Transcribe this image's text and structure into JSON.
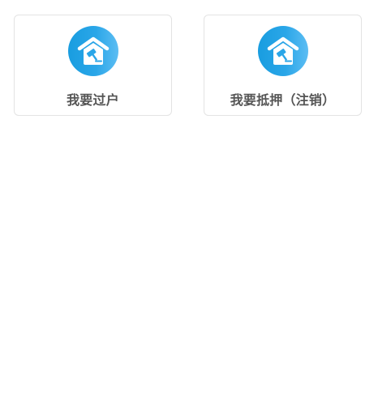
{
  "cards": [
    {
      "label": "我要过户",
      "icon": "house-gavel-icon"
    },
    {
      "label": "我要抵押（注销）",
      "icon": "house-gavel-icon"
    }
  ],
  "colors": {
    "icon_gradient_start": "#199de0",
    "icon_gradient_end": "#5cbdf3",
    "label_text": "#555555",
    "card_border": "#e3e3e3"
  }
}
